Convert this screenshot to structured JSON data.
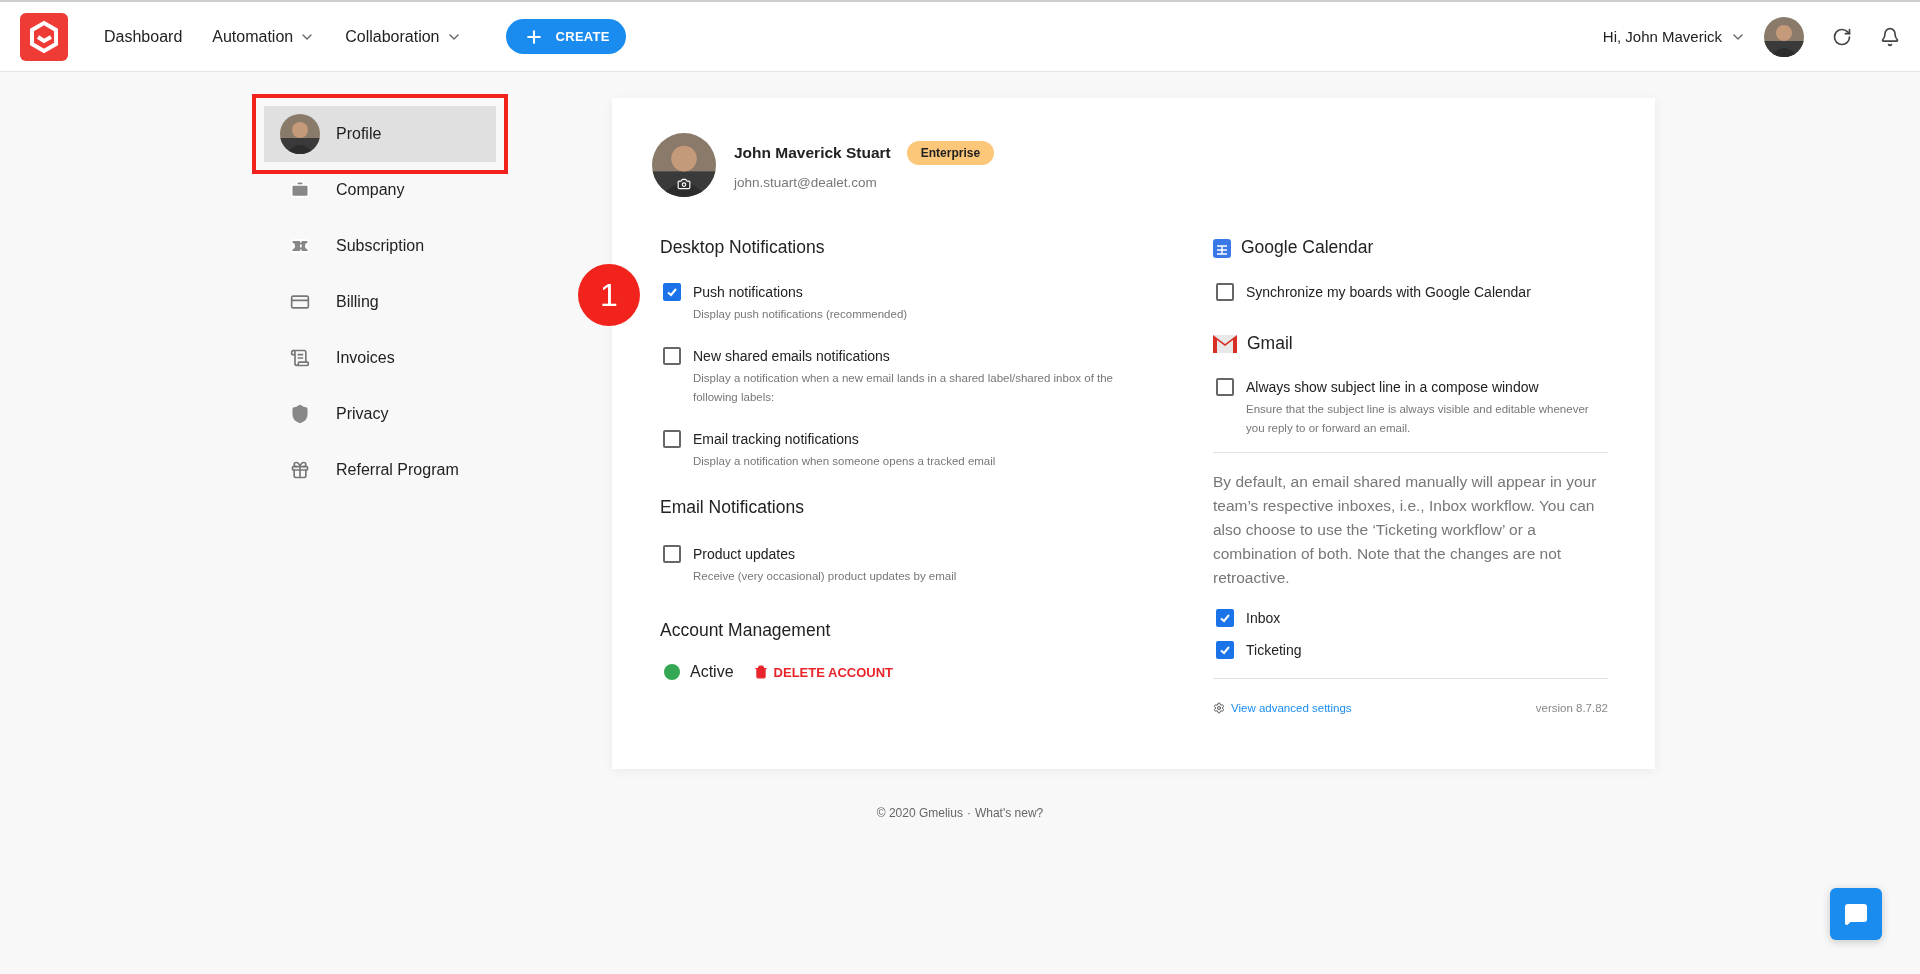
{
  "header": {
    "nav": [
      {
        "label": "Dashboard",
        "has_menu": false
      },
      {
        "label": "Automation",
        "has_menu": true
      },
      {
        "label": "Collaboration",
        "has_menu": true
      }
    ],
    "create_button": {
      "label": "CREATE"
    },
    "user": {
      "greeting": "Hi, John Maverick"
    }
  },
  "sidebar": {
    "items": [
      {
        "label": "Profile",
        "selected": true,
        "highlighted": true
      },
      {
        "label": "Company",
        "selected": false,
        "highlighted": false
      },
      {
        "label": "Subscription",
        "selected": false,
        "highlighted": false
      },
      {
        "label": "Billing",
        "selected": false,
        "highlighted": false
      },
      {
        "label": "Invoices",
        "selected": false,
        "highlighted": false
      },
      {
        "label": "Privacy",
        "selected": false,
        "highlighted": false
      },
      {
        "label": "Referral Program",
        "selected": false,
        "highlighted": false
      }
    ]
  },
  "profile": {
    "name": "John Maverick Stuart",
    "plan": "Enterprise",
    "email": "john.stuart@dealet.com"
  },
  "desktop_notifications": {
    "title": "Desktop Notifications",
    "options": [
      {
        "label": "Push notifications",
        "description": "Display push notifications (recommended)",
        "checked": true,
        "marker": "1"
      },
      {
        "label": "New shared emails notifications",
        "description": "Display a notification when a new email lands in a shared label/shared inbox of the following labels:",
        "checked": false
      },
      {
        "label": "Email tracking notifications",
        "description": "Display a notification when someone opens a tracked email",
        "checked": false
      }
    ]
  },
  "email_notifications": {
    "title": "Email Notifications",
    "options": [
      {
        "label": "Product updates",
        "description": "Receive (very occasional) product updates by email",
        "checked": false
      }
    ]
  },
  "account_management": {
    "title": "Account Management",
    "status": {
      "label": "Active",
      "color": "#34a853"
    },
    "delete_label": "DELETE ACCOUNT"
  },
  "google_calendar": {
    "title": "Google Calendar",
    "options": [
      {
        "label": "Synchronize my boards with Google Calendar",
        "checked": false
      }
    ]
  },
  "gmail": {
    "title": "Gmail",
    "options": [
      {
        "label": "Always show subject line in a compose window",
        "description": "Ensure that the subject line is always visible and editable whenever you reply to or forward an email.",
        "checked": false
      }
    ]
  },
  "workflow": {
    "text": "By default, an email shared manually will appear in your team’s respective inboxes, i.e., Inbox workflow. You can also choose to use the ‘Ticketing workflow’ or a combination of both. Note that the changes are not retroactive.",
    "options": [
      {
        "label": "Inbox",
        "checked": true
      },
      {
        "label": "Ticketing",
        "checked": true
      }
    ]
  },
  "advanced_link": "View advanced settings",
  "version": "version 8.7.82",
  "footer": {
    "copyright": "© 2020 Gmelius",
    "separator": "·",
    "link": "What's new?"
  }
}
